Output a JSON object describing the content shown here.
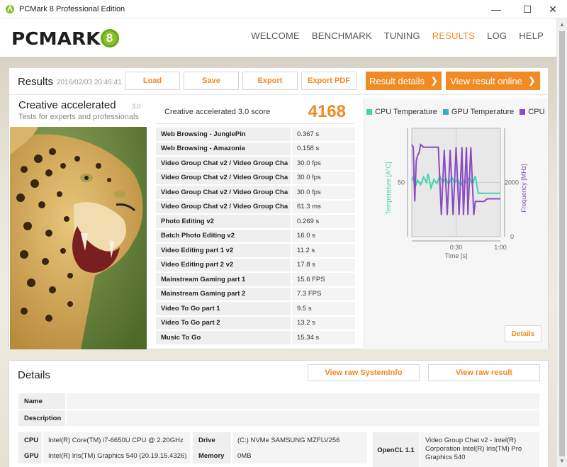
{
  "window": {
    "title": "PCMark 8 Professional Edition",
    "minimize_glyph": "—",
    "maximize_glyph": "☐",
    "close_glyph": "✕"
  },
  "logo": {
    "text": "PCMARK",
    "badge": "8"
  },
  "nav": {
    "items": [
      {
        "label": "WELCOME"
      },
      {
        "label": "BENCHMARK"
      },
      {
        "label": "TUNING"
      },
      {
        "label": "RESULTS"
      },
      {
        "label": "LOG"
      },
      {
        "label": "HELP"
      }
    ],
    "active": "RESULTS"
  },
  "results": {
    "title": "Results",
    "date": "2016/02/03 20:46:41",
    "buttons": {
      "load": "Load",
      "save": "Save",
      "export": "Export",
      "export_pdf": "Export PDF",
      "result_details": "Result details",
      "view_online": "View result online",
      "chevron": "❯"
    },
    "test": {
      "name": "Creative accelerated",
      "version": "3.0",
      "description": "Tests for experts and professionals"
    },
    "score": {
      "label": "Creative accelerated 3.0 score",
      "value": "4168"
    },
    "subtests": [
      {
        "name": "Web Browsing - JunglePin",
        "value": "0.367 s"
      },
      {
        "name": "Web Browsing - Amazonia",
        "value": "0.158 s"
      },
      {
        "name": "Video Group Chat v2 / Video Group Cha",
        "value": "30.0 fps"
      },
      {
        "name": "Video Group Chat v2 / Video Group Cha",
        "value": "30.0 fps"
      },
      {
        "name": "Video Group Chat v2 / Video Group Cha",
        "value": "30.0 fps"
      },
      {
        "name": "Video Group Chat v2 / Video Group Cha",
        "value": "61.3 ms"
      },
      {
        "name": "Photo Editing v2",
        "value": "0.269 s"
      },
      {
        "name": "Batch Photo Editing v2",
        "value": "16.0 s"
      },
      {
        "name": "Video Editing part 1 v2",
        "value": "11.2 s"
      },
      {
        "name": "Video Editing part 2 v2",
        "value": "17.8 s"
      },
      {
        "name": "Mainstream Gaming part 1",
        "value": "15.6 FPS"
      },
      {
        "name": "Mainstream Gaming part 2",
        "value": "7.3 FPS"
      },
      {
        "name": "Video To Go part 1",
        "value": "9.5 s"
      },
      {
        "name": "Video To Go part 2",
        "value": "13.2 s"
      },
      {
        "name": "Music To Go",
        "value": "15.34 s"
      }
    ],
    "details_button": "Details"
  },
  "chart_data": {
    "type": "line",
    "legend": [
      {
        "name": "CPU Temperature",
        "color": "#3dd6b0"
      },
      {
        "name": "GPU Temperature",
        "color": "#3aa7e0"
      },
      {
        "name": "CPU Clo",
        "color": "#8a4cc0"
      }
    ],
    "xlabel": "Time [s]",
    "ylabel_left": "Temperature [A°C]",
    "ylabel_right": "Frequency [MHz]",
    "x_ticks": [
      "0:30",
      "1:00"
    ],
    "y_left_ticks": [
      "50"
    ],
    "y_right_ticks": [
      "2000",
      "0"
    ],
    "xlim": [
      0,
      60
    ],
    "ylim_left": [
      0,
      100
    ],
    "ylim_right": [
      0,
      4000
    ],
    "series": [
      {
        "name": "CPU Temperature",
        "axis": "left",
        "x": [
          0,
          1,
          2,
          4,
          6,
          8,
          10,
          11,
          13,
          15,
          17,
          19,
          21,
          23,
          25,
          27,
          29,
          31,
          33,
          35,
          37,
          39,
          41,
          43,
          45,
          47,
          49,
          51,
          53,
          55,
          57,
          60
        ],
        "y": [
          52,
          55,
          45,
          52,
          48,
          55,
          50,
          58,
          45,
          53,
          49,
          56,
          50,
          54,
          48,
          55,
          50,
          53,
          47,
          52,
          50,
          55,
          48,
          56,
          40,
          40,
          40,
          40,
          40,
          40,
          40,
          40
        ]
      },
      {
        "name": "CPU Clock",
        "axis": "right",
        "x": [
          0,
          1,
          2,
          3,
          4,
          5,
          6,
          8,
          10,
          12,
          14,
          16,
          18,
          20,
          22,
          24,
          26,
          28,
          30,
          32,
          34,
          35,
          37,
          38,
          40,
          42,
          43,
          45,
          47,
          49,
          51,
          53,
          55,
          57,
          60
        ],
        "y": [
          3400,
          3300,
          1300,
          2800,
          3000,
          3100,
          3400,
          3300,
          3300,
          3300,
          3300,
          3300,
          3300,
          800,
          3200,
          800,
          3200,
          800,
          3300,
          800,
          3300,
          800,
          3300,
          800,
          3300,
          800,
          1300,
          1300,
          1300,
          1300,
          1400,
          1400,
          1400,
          1400,
          1400
        ]
      }
    ]
  },
  "details": {
    "title": "Details",
    "buttons": {
      "view_raw_systeminfo": "View raw SystemInfo",
      "view_raw_result": "View raw result"
    },
    "fields": {
      "name_label": "Name",
      "name_value": "",
      "description_label": "Description",
      "description_value": ""
    },
    "hardware": {
      "cpu_label": "CPU",
      "cpu_value": "Intel(R) Core(TM) i7-6650U CPU @ 2.20GHz",
      "gpu_label": "GPU",
      "gpu_value": "Intel(R) Iris(TM) Graphics 540 (20.19.15.4326)",
      "drive_label": "Drive",
      "drive_value": "(C:) NVMe SAMSUNG MZFLV256",
      "memory_label": "Memory",
      "memory_value": "0MB",
      "opencl_label": "OpenCL 1.1",
      "opencl_value": "Video Group Chat v2 - Intel(R) Corporation Intel(R) Iris(TM) Pro Graphics 540"
    }
  }
}
